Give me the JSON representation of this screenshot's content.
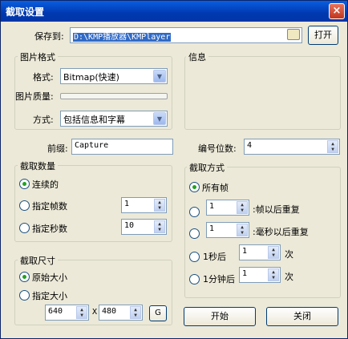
{
  "window": {
    "title": "截取设置",
    "close": "×"
  },
  "save": {
    "label": "保存到:",
    "path": "D:\\KMP播放器\\KMPlayer",
    "open": "打开"
  },
  "format_group": {
    "title": "图片格式",
    "format_label": "格式:",
    "format_value": "Bitmap(快速)",
    "quality_label": "图片质量:",
    "method_label": "方式:",
    "method_value": "包括信息和字幕"
  },
  "info_group": {
    "title": "信息"
  },
  "prefix": {
    "label": "前缀:",
    "value": "Capture"
  },
  "digits": {
    "label": "编号位数:",
    "value": "4"
  },
  "count_group": {
    "title": "截取数量",
    "continuous": "连续的",
    "frames_label": "指定帧数",
    "frames_value": "1",
    "seconds_label": "指定秒数",
    "seconds_value": "10"
  },
  "method_group": {
    "title": "截取方式",
    "all_frames": "所有帧",
    "every_frames_value": "1",
    "every_frames_suffix": ":帧以后重复",
    "every_ms_value": "1",
    "every_ms_suffix": ":毫秒以后重复",
    "after_1s_label": "1秒后",
    "after_1s_value": "1",
    "after_1s_suffix": "次",
    "after_1m_label": "1分钟后",
    "after_1m_value": "1",
    "after_1m_suffix": "次"
  },
  "size_group": {
    "title": "截取尺寸",
    "original": "原始大小",
    "custom": "指定大小",
    "width": "640",
    "x": "X",
    "height": "480",
    "g": "G"
  },
  "buttons": {
    "start": "开始",
    "close": "关闭"
  }
}
